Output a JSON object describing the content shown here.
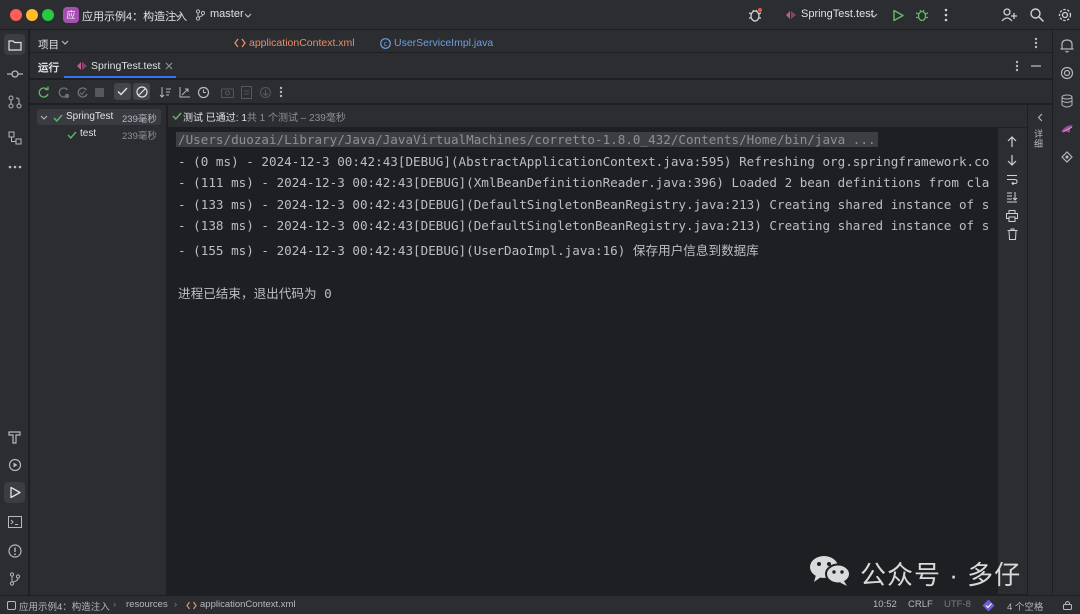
{
  "titlebar": {
    "project_badge": "应",
    "project_name": "应用示例4：构造注入",
    "branch": "master",
    "run_config": "SpringTest.test"
  },
  "sidebar": {
    "project_label": "项目"
  },
  "editor": {
    "tabs": [
      {
        "label": "applicationContext.xml",
        "icon": "xml-file-icon",
        "color": "#e88f6a"
      },
      {
        "label": "UserServiceImpl.java",
        "icon": "java-class-icon",
        "color": "#6f9fe0"
      }
    ]
  },
  "run": {
    "panel_label": "运行",
    "tab_label": "SpringTest.test"
  },
  "tests": {
    "root": {
      "name": "SpringTest",
      "duration": "239毫秒"
    },
    "children": [
      {
        "name": "test",
        "duration": "239毫秒"
      }
    ]
  },
  "status": {
    "prefix": "测试 已通过: 1",
    "detail": "共 1 个测试 – 239毫秒"
  },
  "console": {
    "command": "/Users/duozai/Library/Java/JavaVirtualMachines/corretto-1.8.0_432/Contents/Home/bin/java ...",
    "lines": [
      "- (0 ms) - 2024-12-3 00:42:43[DEBUG](AbstractApplicationContext.java:595) Refreshing org.springframework.co",
      "- (111 ms) - 2024-12-3 00:42:43[DEBUG](XmlBeanDefinitionReader.java:396) Loaded 2 bean definitions from cla",
      "- (133 ms) - 2024-12-3 00:42:43[DEBUG](DefaultSingletonBeanRegistry.java:213) Creating shared instance of s",
      "- (138 ms) - 2024-12-3 00:42:43[DEBUG](DefaultSingletonBeanRegistry.java:213) Creating shared instance of s",
      "- (155 ms) - 2024-12-3 00:42:43[DEBUG](UserDaoImpl.java:16) 保存用户信息到数据库"
    ],
    "exit_message": "进程已结束，退出代码为 0"
  },
  "right_panel_label": "详细",
  "statusbar": {
    "breadcrumb": [
      "应用示例4：构造注入",
      "resources",
      "applicationContext.xml"
    ],
    "position": "10:52",
    "line_ending": "CRLF",
    "encoding": "UTF-8",
    "indent": "4 个空格"
  },
  "watermark": "公众号 · 多仔",
  "colors": {
    "pass": "#5fb865",
    "accent": "#3574f0",
    "background": "#1e1f22",
    "panel": "#2b2d30"
  }
}
